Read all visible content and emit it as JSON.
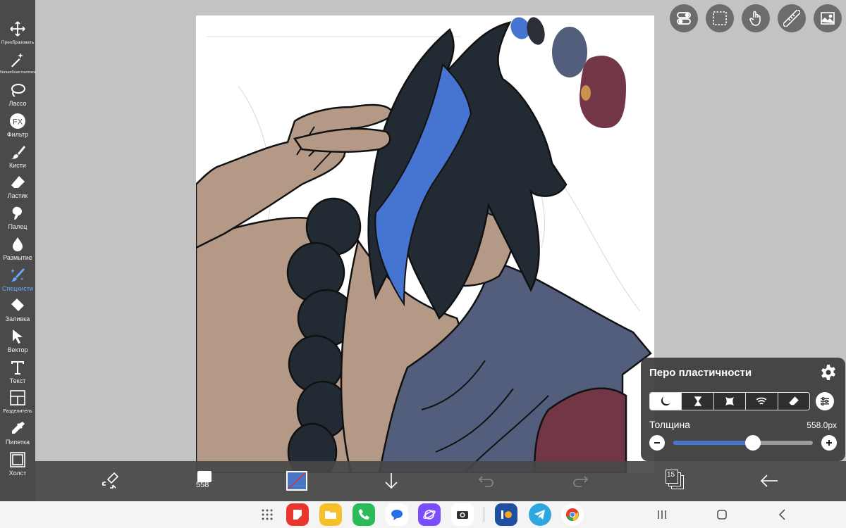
{
  "toolbar": {
    "items": [
      {
        "label": "Преобразовать",
        "icon": "move-icon"
      },
      {
        "label": "Волшебная палочка",
        "icon": "magic-wand-icon"
      },
      {
        "label": "Лассо",
        "icon": "lasso-icon"
      },
      {
        "label": "Фильтр",
        "icon": "fx-icon"
      },
      {
        "label": "Кисти",
        "icon": "brush-icon"
      },
      {
        "label": "Ластик",
        "icon": "eraser-icon"
      },
      {
        "label": "Палец",
        "icon": "smudge-icon"
      },
      {
        "label": "Размытие",
        "icon": "blur-drop-icon"
      },
      {
        "label": "Спецкисти",
        "icon": "special-brush-icon"
      },
      {
        "label": "Заливка",
        "icon": "fill-bucket-icon"
      },
      {
        "label": "Вектор",
        "icon": "vector-arrow-icon"
      },
      {
        "label": "Текст",
        "icon": "text-icon"
      },
      {
        "label": "Разделитель",
        "icon": "frame-divider-icon"
      },
      {
        "label": "Пипетка",
        "icon": "eyedropper-icon"
      },
      {
        "label": "Холст",
        "icon": "canvas-icon"
      }
    ],
    "active_label": "Спецкисти"
  },
  "top_buttons": [
    "toggle-icon",
    "selection-icon",
    "touch-hand-icon",
    "ruler-icon",
    "image-icon"
  ],
  "brush_panel": {
    "title": "Перо пластичности",
    "modes": [
      "moon-mode-icon",
      "hourglass-mode-icon",
      "shape-mode-icon",
      "wave-mode-icon",
      "eraser-mode-icon"
    ],
    "selected_mode": 0,
    "thickness_label": "Толщина",
    "thickness_value": "558.0px",
    "slider_fraction": 0.57
  },
  "bottom_bar": {
    "brush_size": "558",
    "layer_count": "15",
    "color": "#4a76c8"
  },
  "colors": {
    "accent": "#4a76c8",
    "toolbar_bg": "#4a4a4a",
    "hair": "#222a33",
    "skin": "#b59987",
    "armor": "#525e7c",
    "sleeve": "#733646",
    "streak": "#4575d0",
    "swatch_orange": "#c9934e"
  }
}
